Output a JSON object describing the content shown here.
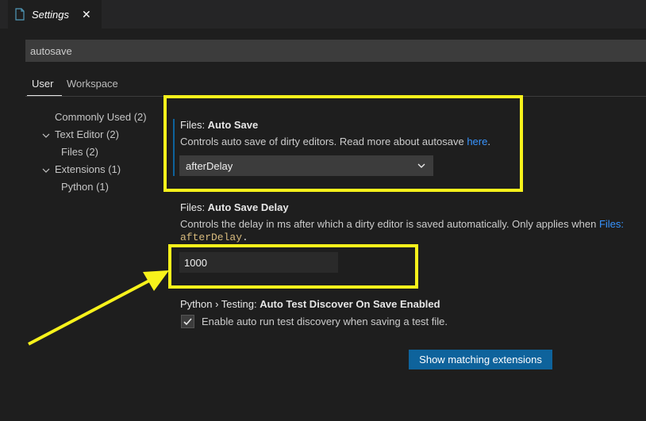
{
  "tab": {
    "title": "Settings",
    "close": "✕"
  },
  "search": {
    "value": "autosave"
  },
  "scope_tabs": {
    "user": "User",
    "workspace": "Workspace"
  },
  "toc": [
    {
      "label": "Commonly Used (2)"
    },
    {
      "label": "Text Editor (2)"
    },
    {
      "label": "Files (2)"
    },
    {
      "label": "Extensions (1)"
    },
    {
      "label": "Python (1)"
    }
  ],
  "settings": {
    "auto_save": {
      "category": "Files: ",
      "name": "Auto Save",
      "description": "Controls auto save of dirty editors. Read more about autosave ",
      "link": "here",
      "period": ".",
      "value": "afterDelay"
    },
    "auto_save_delay": {
      "category": "Files: ",
      "name": "Auto Save Delay",
      "description": "Controls the delay in ms after which a dirty editor is saved automatically. Only applies when ",
      "link": "Files:",
      "mono": "afterDelay",
      "period": ".",
      "value": "1000"
    },
    "python_testing": {
      "category": "Python › Testing: ",
      "name": "Auto Test Discover On Save Enabled",
      "checkbox_label": "Enable auto run test discovery when saving a test file.",
      "checked": true
    }
  },
  "button": {
    "label": "Show matching extensions"
  },
  "colors": {
    "accent": "#0e639c",
    "highlight": "#f7f21b",
    "link": "#3794ff"
  }
}
